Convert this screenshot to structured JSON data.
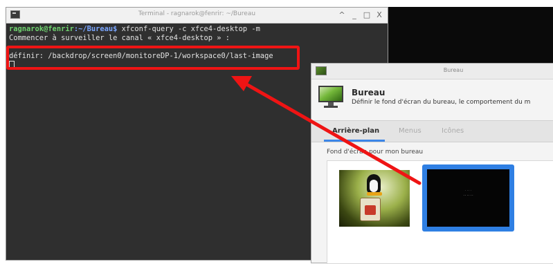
{
  "terminal": {
    "title": "Terminal - ragnarok@fenrir: ~/Bureau",
    "window_buttons": [
      "^",
      "_",
      "□",
      "X"
    ],
    "prompt_user": "ragnarok@fenrir",
    "prompt_path": ":~/Bureau$",
    "command": " xfconf-query -c xfce4-desktop -m",
    "line2": "Commencer à surveiller le canal « xfce4-desktop » :",
    "line3": "",
    "output": "définir: /backdrop/screen0/monitoreDP-1/workspace0/last-image"
  },
  "bureau": {
    "window_title": "Bureau",
    "header_title": "Bureau",
    "header_subtitle": "Définir le fond d'écran du bureau, le comportement du m",
    "tabs": [
      {
        "label": "Arrière-plan",
        "active": true
      },
      {
        "label": "Menus",
        "active": false
      },
      {
        "label": "Icônes",
        "active": false
      }
    ],
    "section_label": "Fond d'écran pour mon bureau",
    "thumb_black_text1": "· · · ·",
    "thumb_black_text2": "· · · · · ·"
  },
  "colors": {
    "highlight": "#ef1414",
    "selection": "#2f7fe3",
    "terminal_bg": "#2f2f2f"
  }
}
